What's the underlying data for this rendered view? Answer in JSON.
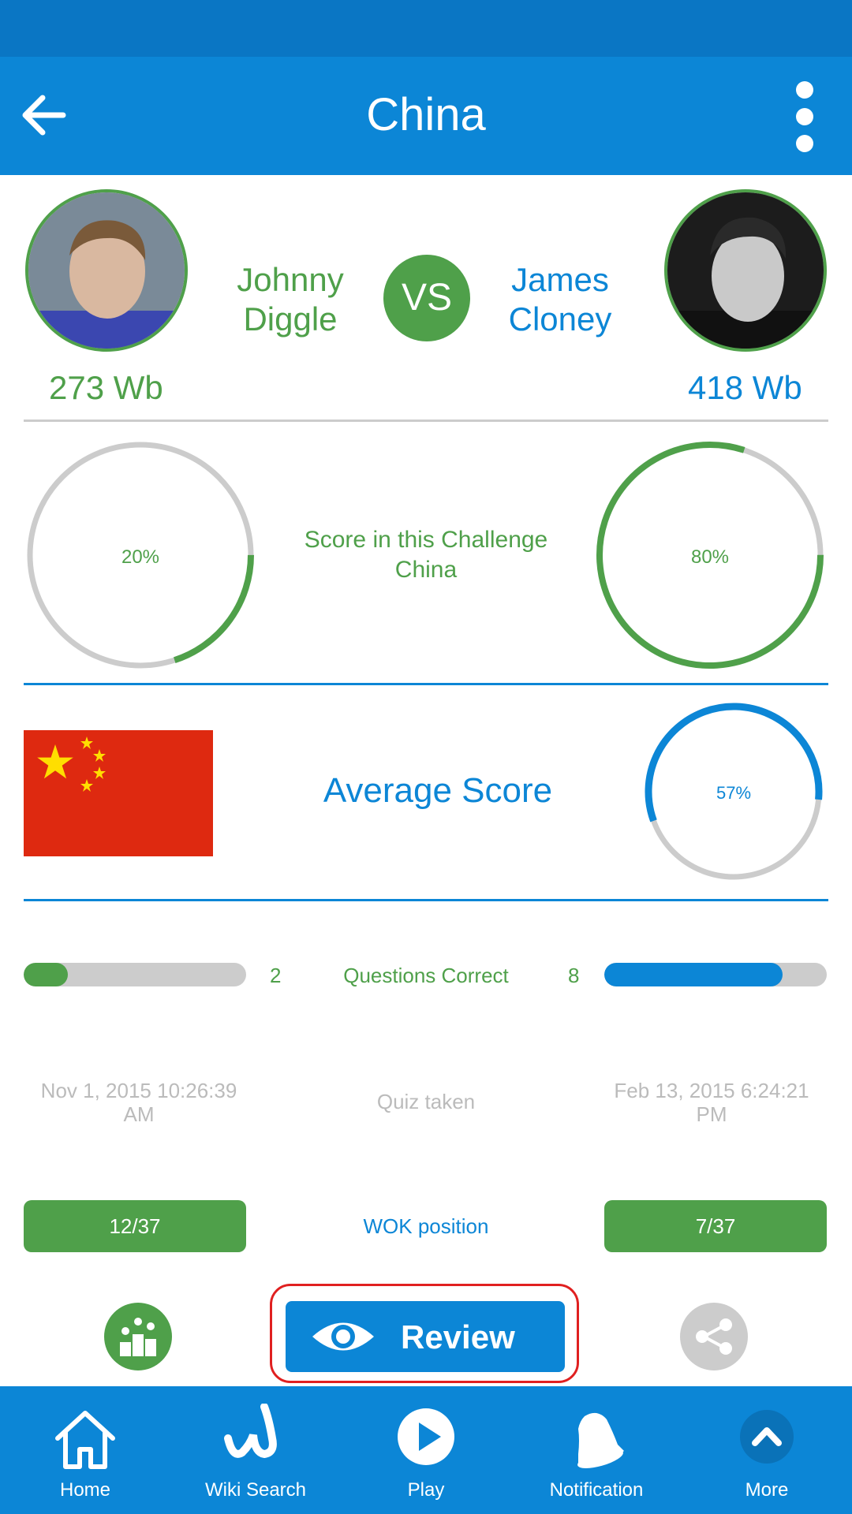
{
  "app_bar": {
    "title": "China"
  },
  "players": {
    "left": {
      "name_line1": "Johnny",
      "name_line2": "Diggle",
      "wb": "273 Wb",
      "score_pct": "20%",
      "questions_correct": "2",
      "quiz_date_line1": "Nov 1, 2015 10:26:39",
      "quiz_date_line2": "AM",
      "wok_position": "12/37"
    },
    "right": {
      "name_line1": "James",
      "name_line2": "Cloney",
      "wb": "418 Wb",
      "score_pct": "80%",
      "questions_correct": "8",
      "quiz_date_line1": "Feb 13, 2015 6:24:21",
      "quiz_date_line2": "PM",
      "wok_position": "7/37"
    }
  },
  "vs_label": "VS",
  "challenge": {
    "label_line1": "Score in this Challenge",
    "label_line2": "China"
  },
  "average": {
    "label": "Average Score",
    "pct": "57%"
  },
  "labels": {
    "questions_correct": "Questions Correct",
    "quiz_taken": "Quiz taken",
    "wok_position": "WOK position"
  },
  "progress": {
    "left_score": 0.2,
    "right_score": 0.8,
    "average": 0.57,
    "left_bar": 0.2,
    "right_bar": 0.8
  },
  "review_button": {
    "label": "Review"
  },
  "bottom_nav": [
    {
      "label": "Home",
      "icon": "home-icon"
    },
    {
      "label": "Wiki Search",
      "icon": "wiki-w-icon"
    },
    {
      "label": "Play",
      "icon": "play-icon"
    },
    {
      "label": "Notification",
      "icon": "bell-icon"
    },
    {
      "label": "More",
      "icon": "chevron-up-icon"
    }
  ],
  "colors": {
    "primary_blue": "#0c86d6",
    "green": "#4fa04a",
    "gray": "#cccccc",
    "highlight_red": "#e02020"
  }
}
